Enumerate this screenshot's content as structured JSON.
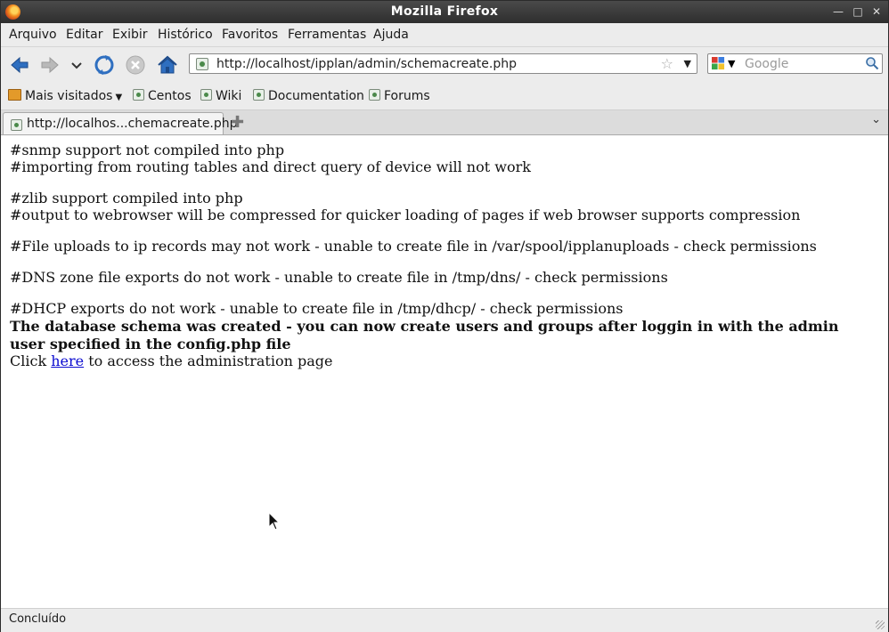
{
  "window": {
    "title": "Mozilla Firefox",
    "controls": [
      "minimize-icon",
      "maximize-icon",
      "close-icon"
    ]
  },
  "menubar": {
    "items": [
      "Arquivo",
      "Editar",
      "Exibir",
      "Histórico",
      "Favoritos",
      "Ferramentas",
      "Ajuda"
    ]
  },
  "navbar": {
    "icons": [
      "back-arrow-icon",
      "forward-arrow-icon",
      "history-dropdown-icon",
      "reload-icon",
      "stop-icon",
      "home-icon"
    ],
    "url": "http://localhost/ipplan/admin/schemacreate.php",
    "search_placeholder": "Google"
  },
  "bookmarks": {
    "items": [
      "Mais visitados",
      "Centos",
      "Wiki",
      "Documentation",
      "Forums"
    ]
  },
  "tabs": {
    "active_label": "http://localhos...chemacreate.php"
  },
  "content": {
    "lines": [
      "#snmp support not compiled into php",
      "#importing from routing tables and direct query of device will not work",
      "#zlib support compiled into php",
      "#output to webrowser will be compressed for quicker loading of pages if web browser supports compression",
      "#File uploads to ip records may not work - unable to create file in /var/spool/ipplanuploads - check permissions",
      "#DNS zone file exports do not work - unable to create file in /tmp/dns/ - check permissions",
      "#DHCP exports do not work - unable to create file in /tmp/dhcp/ - check permissions"
    ],
    "bold_line1": "The database schema was created - you can now create users and groups after loggin in with the admin",
    "bold_line2": "user specified in the config.php file",
    "click_prefix": "Click",
    "link_text": "here",
    "click_suffix": "to access the administration page"
  },
  "statusbar": {
    "text": "Concluído"
  },
  "colors": {
    "link": "#0b0bd0",
    "titlebar": "#2e2e2e"
  }
}
